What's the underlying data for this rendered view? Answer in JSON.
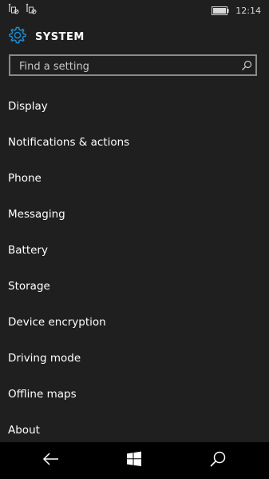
{
  "status": {
    "time": "12:14",
    "icons": [
      "sim-no-signal-icon",
      "sim-no-signal-icon",
      "battery-icon"
    ]
  },
  "header": {
    "icon": "gear-icon",
    "title": "SYSTEM"
  },
  "search": {
    "placeholder": "Find a setting",
    "value": "",
    "icon": "search-icon"
  },
  "menu": {
    "items": [
      {
        "label": "Display"
      },
      {
        "label": "Notifications & actions"
      },
      {
        "label": "Phone"
      },
      {
        "label": "Messaging"
      },
      {
        "label": "Battery"
      },
      {
        "label": "Storage"
      },
      {
        "label": "Device encryption"
      },
      {
        "label": "Driving mode"
      },
      {
        "label": "Offline maps"
      },
      {
        "label": "About"
      }
    ]
  },
  "nav": {
    "icons": [
      "back-arrow-icon",
      "windows-start-icon",
      "search-icon"
    ]
  },
  "colors": {
    "accent": "#1e90d6",
    "background": "#1f1f1f",
    "nav_background": "#000000"
  }
}
